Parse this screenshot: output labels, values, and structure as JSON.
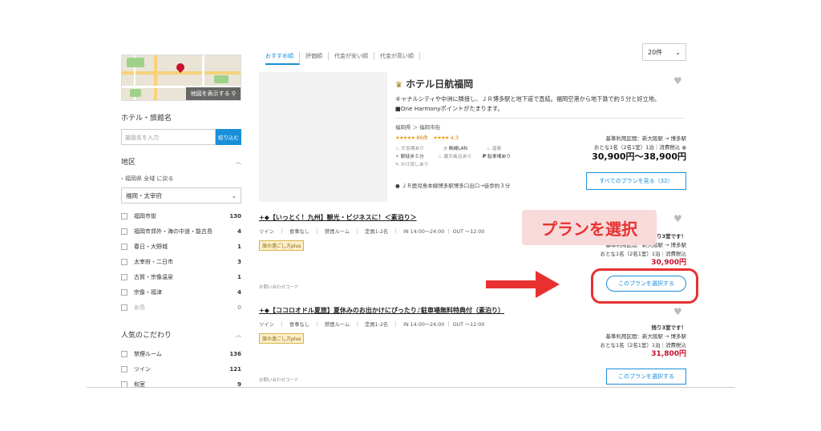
{
  "sidebar": {
    "map_button": "地図を表示する",
    "hotel_name_title": "ホテル・旅館名",
    "hotel_name_placeholder": "施設名を入力",
    "narrow_button": "絞り込む",
    "area_title": "地区",
    "back_link": "福岡県 全域 に戻る",
    "region_select": "福岡・太宰府",
    "areas": [
      {
        "label": "福岡市街",
        "count": "130"
      },
      {
        "label": "福岡市郊外・海の中道・能古島",
        "count": "4"
      },
      {
        "label": "春日・大野城",
        "count": "1"
      },
      {
        "label": "太宰府・二日市",
        "count": "3"
      },
      {
        "label": "古賀・宗像温泉",
        "count": "1"
      },
      {
        "label": "宗像・福津",
        "count": "4"
      },
      {
        "label": "糸島",
        "count": "0"
      }
    ],
    "popular_title": "人気のこだわり",
    "popular": [
      {
        "label": "禁煙ルーム",
        "count": "136"
      },
      {
        "label": "ツイン",
        "count": "121"
      },
      {
        "label": "和室",
        "count": "9"
      }
    ]
  },
  "sort": {
    "options": [
      "おすすめ順",
      "評価順",
      "代金が安い順",
      "代金が高い順"
    ],
    "per_page": "20件"
  },
  "hotel": {
    "crown_icon": "♛",
    "name": "ホテル日航福岡",
    "description_1": "キャナルシティや中洲に隣接し、ＪＲ博多駅と地下道で直結。福岡空港から地下鉄で約５分と好立地。",
    "description_2": "■One Harmonyポイントがたまります。",
    "breadcrumb": "福岡県 ＞ 福岡市街",
    "review_stars": "★★★★★",
    "review_count": "86件",
    "rating_stars": "★★★★",
    "rating_value": "4.3",
    "amenities_row1": [
      "大浴場あり",
      "無線LAN",
      "温泉"
    ],
    "amenities_row2": [
      "駅徒歩５分",
      "露天風呂あり",
      "駐車場あり"
    ],
    "amenities_row3": [
      "かけ流しあり"
    ],
    "station": "ＪＲ鹿児島本線博多駅博多口出口→徒歩約３分",
    "price_note_1": "基準利用区間：新大阪駅 → 博多駅",
    "price_note_2": "おとな1名（2名1室）1泊｜消費税込",
    "price_range": "30,900円〜38,900円",
    "all_plans_button": "すべてのプランを見る（32）"
  },
  "plans": [
    {
      "title": "+◆【いっとく！九州】観光・ビジネスに！＜素泊り＞",
      "attrs": "ツイン　｜　食事なし　｜　禁煙ルーム　｜　定員1-2名　｜　IN 14:00〜24:00 ｜ OUT 〜12:00",
      "badge": "旅の過ごし方plus",
      "inquiry": "お問い合わせコード",
      "remaining": "残り3室です！",
      "note_1": "基準利用区間：新大阪駅 → 博多駅",
      "note_2": "おとな1名（2名1室）1泊｜消費税込",
      "price": "30,900円",
      "button": "このプランを選択する"
    },
    {
      "title": "+◆【ココロオドル夏旅】夏休みのお出かけにぴったり♪駐車場無料特典付（素泊り）",
      "attrs": "ツイン　｜　食事なし　｜　禁煙ルーム　｜　定員1-2名　｜　IN 14:00〜24:00 ｜ OUT 〜12:00",
      "badge": "旅の過ごし方plus",
      "inquiry": "お問い合わせコード",
      "remaining": "残り3室です！",
      "note_1": "基準利用区間：新大阪駅 → 博多駅",
      "note_2": "おとな1名（2名1室）1泊｜消費税込",
      "price": "31,800円",
      "button": "このプランを選択する"
    }
  ],
  "annotation": {
    "label": "プランを選択",
    "color": "#e8312f"
  },
  "colors": {
    "accent": "#1a8fd8",
    "price_red": "#c8102e"
  }
}
